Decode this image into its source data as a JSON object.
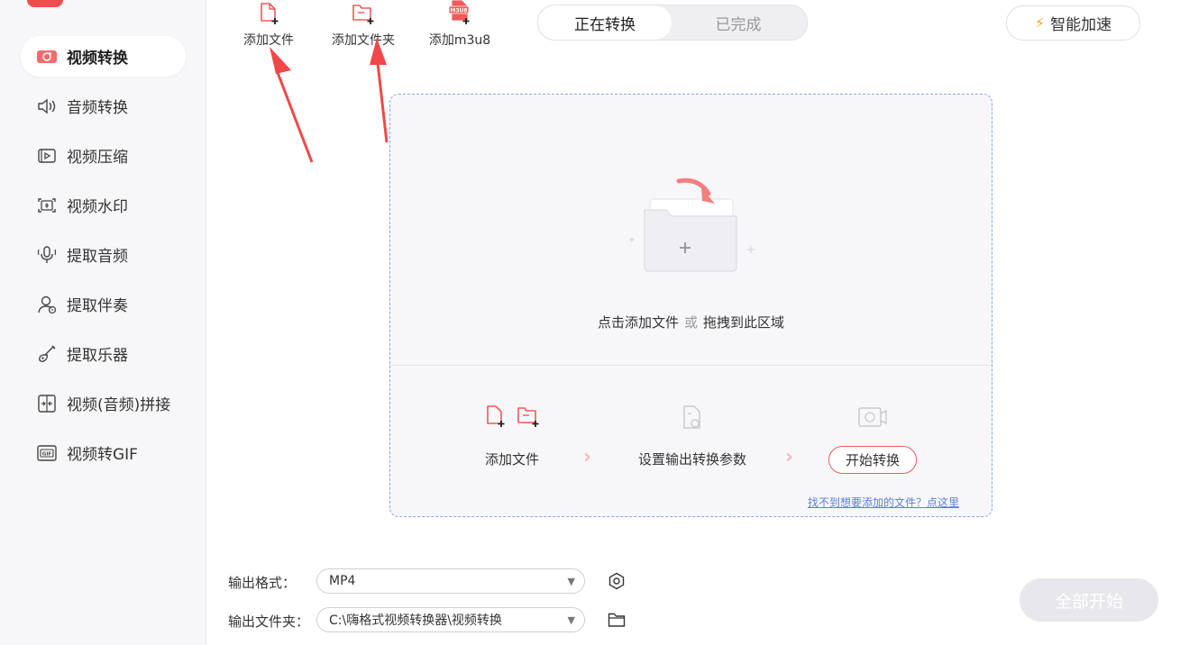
{
  "sidebar": {
    "items": [
      {
        "label": "视频转换",
        "icon": "video-convert-icon",
        "active": true
      },
      {
        "label": "音频转换",
        "icon": "speaker-icon"
      },
      {
        "label": "视频压缩",
        "icon": "compress-icon"
      },
      {
        "label": "视频水印",
        "icon": "watermark-icon"
      },
      {
        "label": "提取音频",
        "icon": "microphone-icon"
      },
      {
        "label": "提取伴奏",
        "icon": "accompaniment-icon"
      },
      {
        "label": "提取乐器",
        "icon": "guitar-icon"
      },
      {
        "label": "视频(音频)拼接",
        "icon": "merge-icon"
      },
      {
        "label": "视频转GIF",
        "icon": "gif-icon"
      }
    ]
  },
  "toolbar": {
    "add_file": "添加文件",
    "add_folder": "添加文件夹",
    "add_m3u8": "添加m3u8",
    "m3u8_badge": "M3U8"
  },
  "tabs": {
    "converting": "正在转换",
    "done": "已完成"
  },
  "speed_button": "智能加速",
  "dropzone": {
    "hint_a": "点击添加文件",
    "hint_or": "或",
    "hint_b": "拖拽到此区域",
    "steps": {
      "add_file": "添加文件",
      "set_params": "设置输出转换参数",
      "start": "开始转换"
    },
    "help_link": "找不到想要添加的文件？点这里"
  },
  "output": {
    "format_label": "输出格式：",
    "format_value": "MP4",
    "folder_label": "输出文件夹：",
    "folder_value": "C:\\嗨格式视频转换器\\视频转换"
  },
  "all_start": "全部开始",
  "colors": {
    "accent_red": "#ef5a5a",
    "dashed_border": "#8ea6e8",
    "link_blue": "#5b7fd6",
    "bolt_orange": "#f5a623"
  }
}
